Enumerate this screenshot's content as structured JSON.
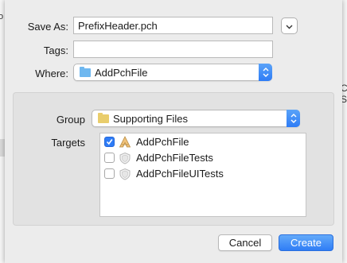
{
  "background": {
    "left_glyph": "o",
    "right_glyphs": [
      "C",
      "S"
    ]
  },
  "dialog": {
    "save_as_label": "Save As:",
    "save_as_value": "PrefixHeader.pch",
    "tags_label": "Tags:",
    "tags_value": "",
    "where_label": "Where:",
    "where_value": "AddPchFile",
    "where_folder_color": "#6fb8f0",
    "group_label": "Group",
    "group_value": "Supporting Files",
    "group_folder_color": "#e9cd6c",
    "targets_label": "Targets",
    "targets": [
      {
        "name": "AddPchFile",
        "checked": true,
        "icon": "app-target-icon"
      },
      {
        "name": "AddPchFileTests",
        "checked": false,
        "icon": "test-target-icon"
      },
      {
        "name": "AddPchFileUITests",
        "checked": false,
        "icon": "test-target-icon"
      }
    ],
    "cancel_label": "Cancel",
    "create_label": "Create"
  },
  "colors": {
    "accent": "#2e7cf6",
    "sheet_bg": "#ececec"
  }
}
